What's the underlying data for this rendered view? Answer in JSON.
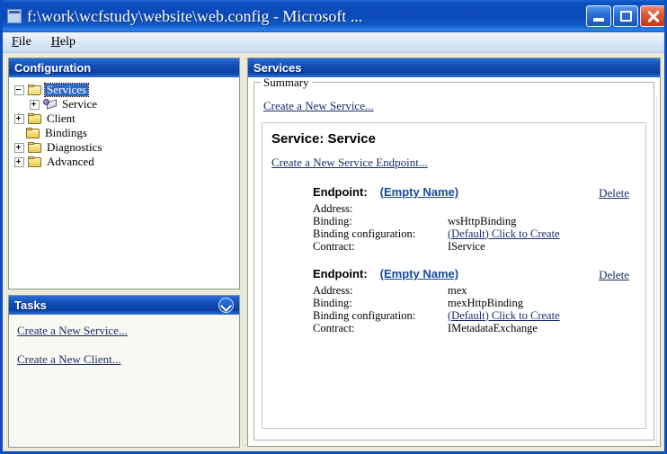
{
  "window": {
    "title": "f:\\work\\wcfstudy\\website\\web.config - Microsoft ...",
    "icon": "app-icon",
    "buttons": {
      "minimize": "minimize-button",
      "maximize": "maximize-button",
      "close": "close-button"
    },
    "accent_color": "#0A49B6",
    "frame_color": "#0A4FBF",
    "desktop_color": "#ECE9D8"
  },
  "menu": {
    "items": [
      {
        "label": "File",
        "accesskey": "F"
      },
      {
        "label": "Help",
        "accesskey": "H"
      }
    ]
  },
  "configuration": {
    "header": "Configuration",
    "tree": [
      {
        "label": "Services",
        "level": 0,
        "expander": "minus",
        "icon": "folder-open-icon",
        "selected": true
      },
      {
        "label": "Service",
        "level": 1,
        "expander": "plus",
        "icon": "service-icon",
        "selected": false
      },
      {
        "label": "Client",
        "level": 0,
        "expander": "plus",
        "icon": "folder-icon",
        "selected": false
      },
      {
        "label": "Bindings",
        "level": 0,
        "expander": "none",
        "icon": "folder-icon",
        "selected": false
      },
      {
        "label": "Diagnostics",
        "level": 0,
        "expander": "plus",
        "icon": "folder-icon",
        "selected": false
      },
      {
        "label": "Advanced",
        "level": 0,
        "expander": "plus",
        "icon": "folder-icon",
        "selected": false
      }
    ]
  },
  "tasks": {
    "header": "Tasks",
    "collapse_icon": "chevron-down-icon",
    "links": [
      "Create a New Service...",
      "Create a New Client..."
    ]
  },
  "services": {
    "header": "Services",
    "summary_legend": "Summary",
    "create_service_link": "Create a New Service...",
    "service_title": "Service: Service",
    "create_endpoint_link": "Create a New Service Endpoint...",
    "endpoints": [
      {
        "label": "Endpoint:",
        "name": "(Empty Name)",
        "delete": "Delete",
        "fields": [
          {
            "key": "Address:",
            "value": "",
            "is_link": false
          },
          {
            "key": "Binding:",
            "value": "wsHttpBinding",
            "is_link": false
          },
          {
            "key": "Binding configuration:",
            "value": "(Default) Click to Create",
            "is_link": true
          },
          {
            "key": "Contract:",
            "value": "IService",
            "is_link": false
          }
        ]
      },
      {
        "label": "Endpoint:",
        "name": "(Empty Name)",
        "delete": "Delete",
        "fields": [
          {
            "key": "Address:",
            "value": "mex",
            "is_link": false
          },
          {
            "key": "Binding:",
            "value": "mexHttpBinding",
            "is_link": false
          },
          {
            "key": "Binding configuration:",
            "value": "(Default) Click to Create",
            "is_link": true
          },
          {
            "key": "Contract:",
            "value": "IMetadataExchange",
            "is_link": false
          }
        ]
      }
    ]
  }
}
